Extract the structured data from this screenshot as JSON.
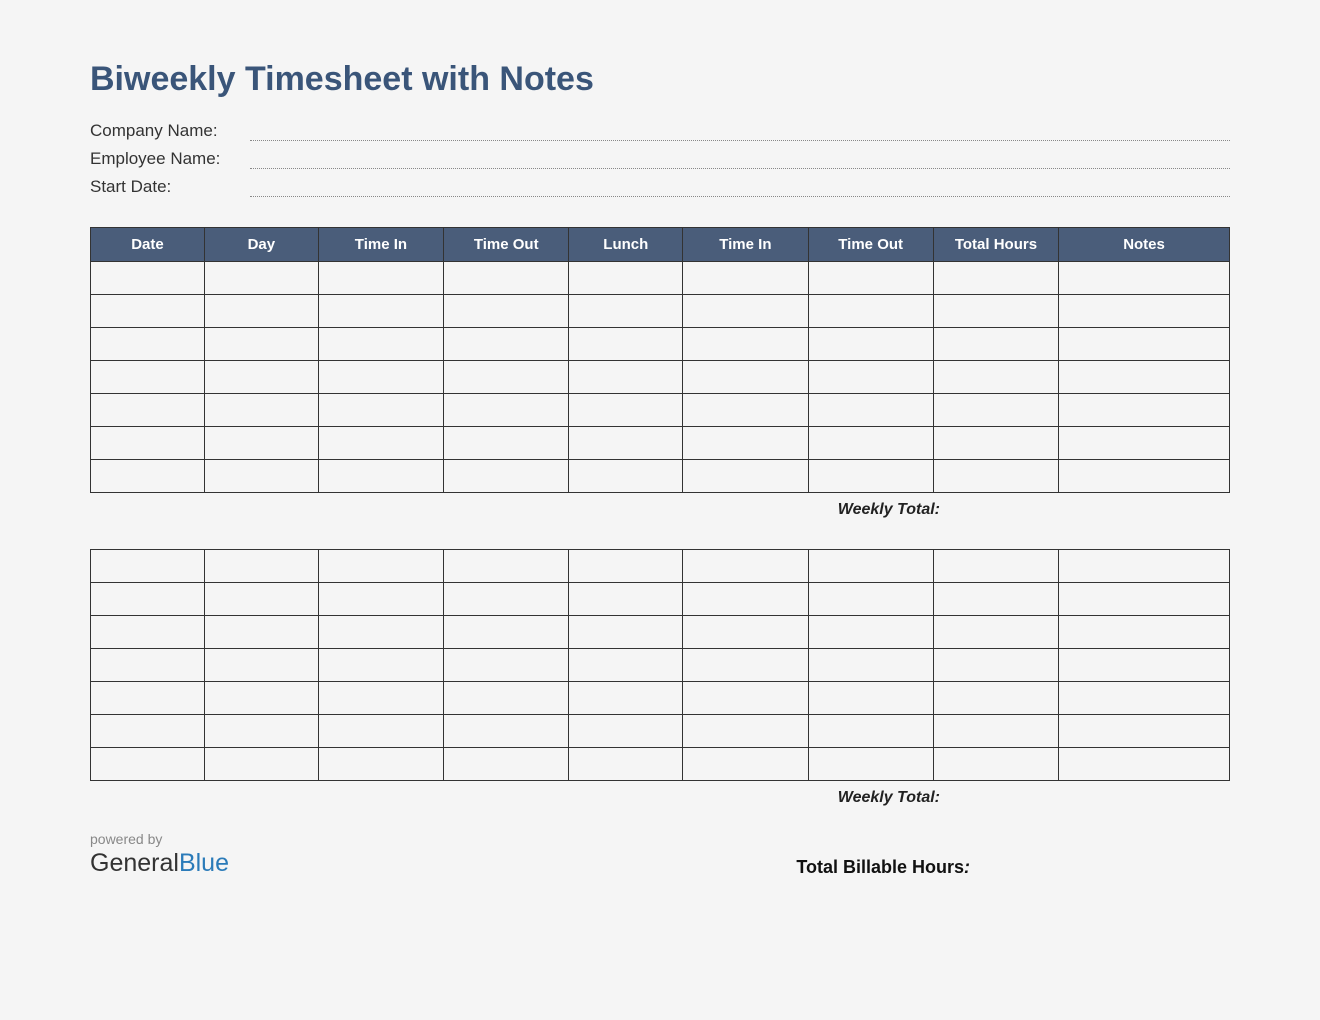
{
  "title": "Biweekly Timesheet with Notes",
  "info": {
    "company_label": "Company Name:",
    "employee_label": "Employee Name:",
    "startdate_label": "Start Date:",
    "company_value": "",
    "employee_value": "",
    "startdate_value": ""
  },
  "headers": {
    "date": "Date",
    "day": "Day",
    "timein1": "Time In",
    "timeout1": "Time Out",
    "lunch": "Lunch",
    "timein2": "Time In",
    "timeout2": "Time Out",
    "total": "Total Hours",
    "notes": "Notes"
  },
  "week1_rows": [
    {
      "date": "",
      "day": "",
      "timein1": "",
      "timeout1": "",
      "lunch": "",
      "timein2": "",
      "timeout2": "",
      "total": "",
      "notes": ""
    },
    {
      "date": "",
      "day": "",
      "timein1": "",
      "timeout1": "",
      "lunch": "",
      "timein2": "",
      "timeout2": "",
      "total": "",
      "notes": ""
    },
    {
      "date": "",
      "day": "",
      "timein1": "",
      "timeout1": "",
      "lunch": "",
      "timein2": "",
      "timeout2": "",
      "total": "",
      "notes": ""
    },
    {
      "date": "",
      "day": "",
      "timein1": "",
      "timeout1": "",
      "lunch": "",
      "timein2": "",
      "timeout2": "",
      "total": "",
      "notes": ""
    },
    {
      "date": "",
      "day": "",
      "timein1": "",
      "timeout1": "",
      "lunch": "",
      "timein2": "",
      "timeout2": "",
      "total": "",
      "notes": ""
    },
    {
      "date": "",
      "day": "",
      "timein1": "",
      "timeout1": "",
      "lunch": "",
      "timein2": "",
      "timeout2": "",
      "total": "",
      "notes": ""
    },
    {
      "date": "",
      "day": "",
      "timein1": "",
      "timeout1": "",
      "lunch": "",
      "timein2": "",
      "timeout2": "",
      "total": "",
      "notes": ""
    }
  ],
  "week2_rows": [
    {
      "date": "",
      "day": "",
      "timein1": "",
      "timeout1": "",
      "lunch": "",
      "timein2": "",
      "timeout2": "",
      "total": "",
      "notes": ""
    },
    {
      "date": "",
      "day": "",
      "timein1": "",
      "timeout1": "",
      "lunch": "",
      "timein2": "",
      "timeout2": "",
      "total": "",
      "notes": ""
    },
    {
      "date": "",
      "day": "",
      "timein1": "",
      "timeout1": "",
      "lunch": "",
      "timein2": "",
      "timeout2": "",
      "total": "",
      "notes": ""
    },
    {
      "date": "",
      "day": "",
      "timein1": "",
      "timeout1": "",
      "lunch": "",
      "timein2": "",
      "timeout2": "",
      "total": "",
      "notes": ""
    },
    {
      "date": "",
      "day": "",
      "timein1": "",
      "timeout1": "",
      "lunch": "",
      "timein2": "",
      "timeout2": "",
      "total": "",
      "notes": ""
    },
    {
      "date": "",
      "day": "",
      "timein1": "",
      "timeout1": "",
      "lunch": "",
      "timein2": "",
      "timeout2": "",
      "total": "",
      "notes": ""
    },
    {
      "date": "",
      "day": "",
      "timein1": "",
      "timeout1": "",
      "lunch": "",
      "timein2": "",
      "timeout2": "",
      "total": "",
      "notes": ""
    }
  ],
  "labels": {
    "weekly_total": "Weekly Total:",
    "billable_total": "Total Billable Hours",
    "billable_colon": ":",
    "powered_by": "powered by",
    "brand_general": "General",
    "brand_blue": "Blue"
  },
  "totals": {
    "week1_total": "",
    "week2_total": "",
    "billable_value": ""
  },
  "colors": {
    "header_bg": "#4a5d7a",
    "title_color": "#3a5579",
    "brand_blue": "#2b7bb9"
  }
}
